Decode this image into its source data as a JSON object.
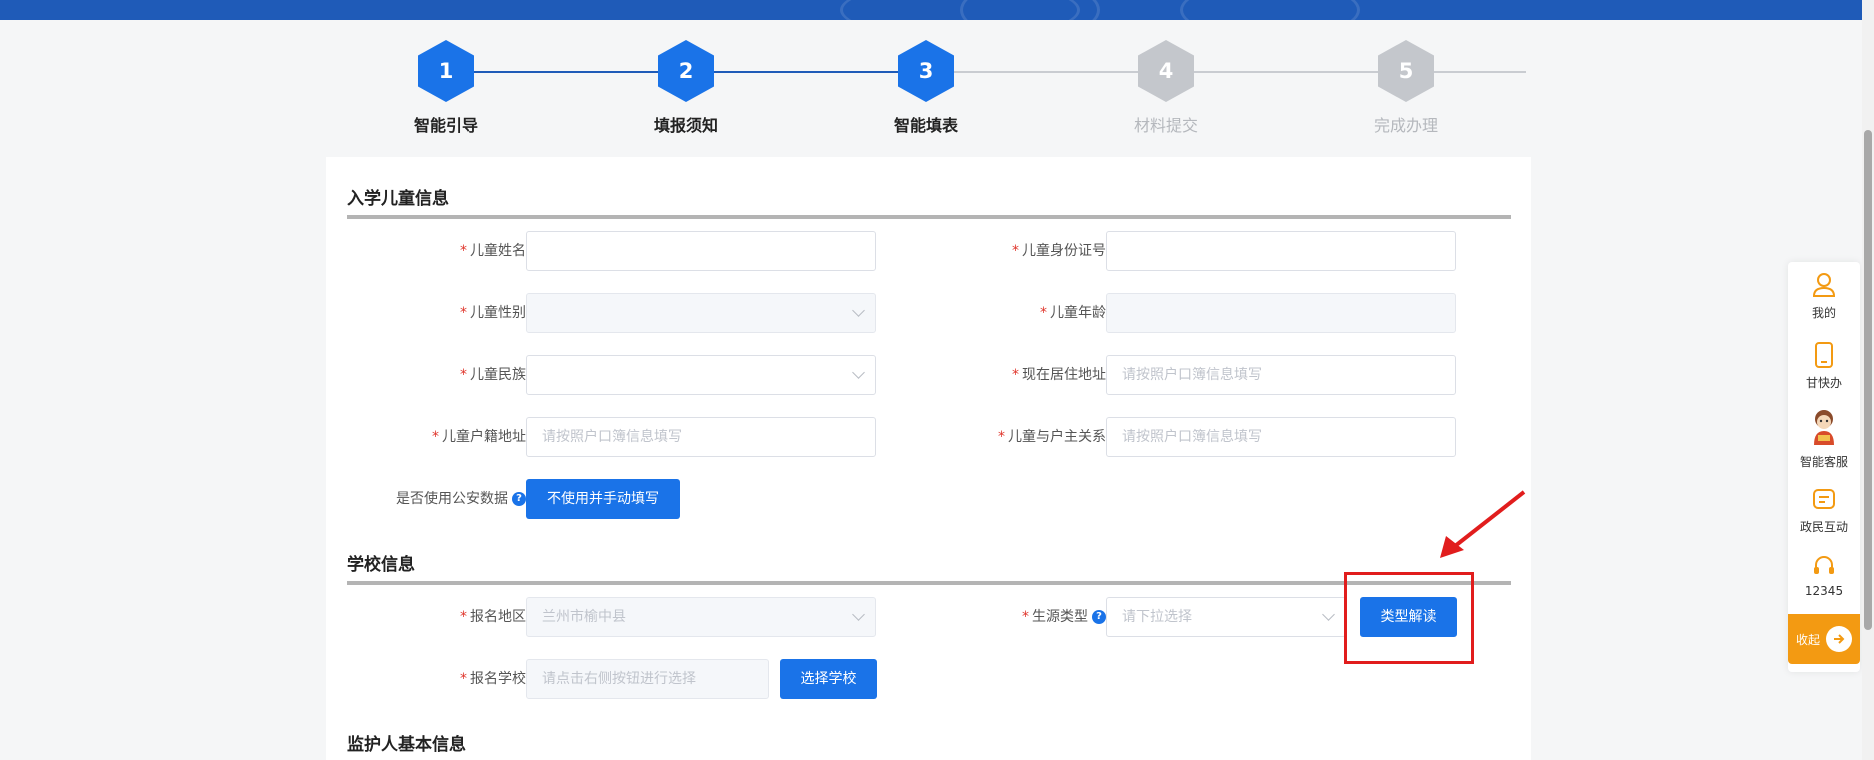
{
  "steps": [
    {
      "num": "1",
      "label": "智能引导",
      "state": "active"
    },
    {
      "num": "2",
      "label": "填报须知",
      "state": "active"
    },
    {
      "num": "3",
      "label": "智能填表",
      "state": "active"
    },
    {
      "num": "4",
      "label": "材料提交",
      "state": "inactive"
    },
    {
      "num": "5",
      "label": "完成办理",
      "state": "inactive"
    }
  ],
  "child_section": {
    "title": "入学儿童信息",
    "name_label": "儿童姓名",
    "id_label": "儿童身份证号",
    "gender_label": "儿童性别",
    "age_label": "儿童年龄",
    "ethnicity_label": "儿童民族",
    "current_addr_label": "现在居住地址",
    "current_addr_placeholder": "请按照户口簿信息填写",
    "hukou_addr_label": "儿童户籍地址",
    "hukou_addr_placeholder": "请按照户口簿信息填写",
    "relation_label": "儿童与户主关系",
    "relation_placeholder": "请按照户口簿信息填写",
    "police_data_label": "是否使用公安数据",
    "manual_fill_button": "不使用并手动填写"
  },
  "school_section": {
    "title": "学校信息",
    "region_label": "报名地区",
    "region_value": "兰州市榆中县",
    "source_type_label": "生源类型",
    "source_type_placeholder": "请下拉选择",
    "type_explain_button": "类型解读",
    "school_label": "报名学校",
    "school_placeholder": "请点击右侧按钮进行选择",
    "choose_school_button": "选择学校"
  },
  "guardian_section": {
    "title": "监护人基本信息"
  },
  "float_bar": {
    "mine": "我的",
    "gankuaiban": "甘快办",
    "smart_service": "智能客服",
    "interaction": "政民互动",
    "hotline": "12345",
    "collapse": "收起"
  },
  "colors": {
    "primary": "#1a73e8",
    "header": "#1f5bb8",
    "inactive_step": "#c4c7cc",
    "required_star": "#e0352b",
    "annotation_red": "#e11d1d",
    "float_accent": "#f39a12"
  }
}
